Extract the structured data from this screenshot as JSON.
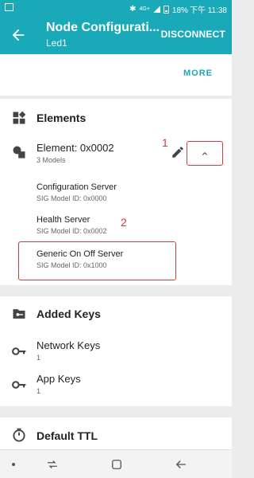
{
  "status_bar": {
    "time_text": "18% 下午 11:38",
    "network": "4G+"
  },
  "app_bar": {
    "title": "Node Configurati...",
    "subtitle": "Led1",
    "action_label": "DISCONNECT"
  },
  "top_card": {
    "more_label": "MORE"
  },
  "elements": {
    "section_title": "Elements",
    "element": {
      "title": "Element: 0x0002",
      "subtitle": "3 Models"
    },
    "models": [
      {
        "title": "Configuration Server",
        "id": "SIG Model ID: 0x0000"
      },
      {
        "title": "Health Server",
        "id": "SIG Model ID: 0x0002"
      },
      {
        "title": "Generic On Off Server",
        "id": "SIG Model ID: 0x1000"
      }
    ],
    "annotation_1": "1",
    "annotation_2": "2"
  },
  "added_keys": {
    "section_title": "Added Keys",
    "network_keys": {
      "title": "Network Keys",
      "count": "1"
    },
    "app_keys": {
      "title": "App Keys",
      "count": "1"
    }
  },
  "default_ttl": {
    "section_title": "Default TTL"
  },
  "icons": {
    "back": "arrow-left-icon",
    "elements": "widgets-icon",
    "element": "shapes-icon",
    "edit": "pencil-icon",
    "collapse": "chevron-up-icon",
    "keys_section": "folder-key-icon",
    "key": "key-icon",
    "ttl": "timer-icon"
  },
  "colors": {
    "accent": "#1aa9b8",
    "annotation": "#d63a3a"
  }
}
